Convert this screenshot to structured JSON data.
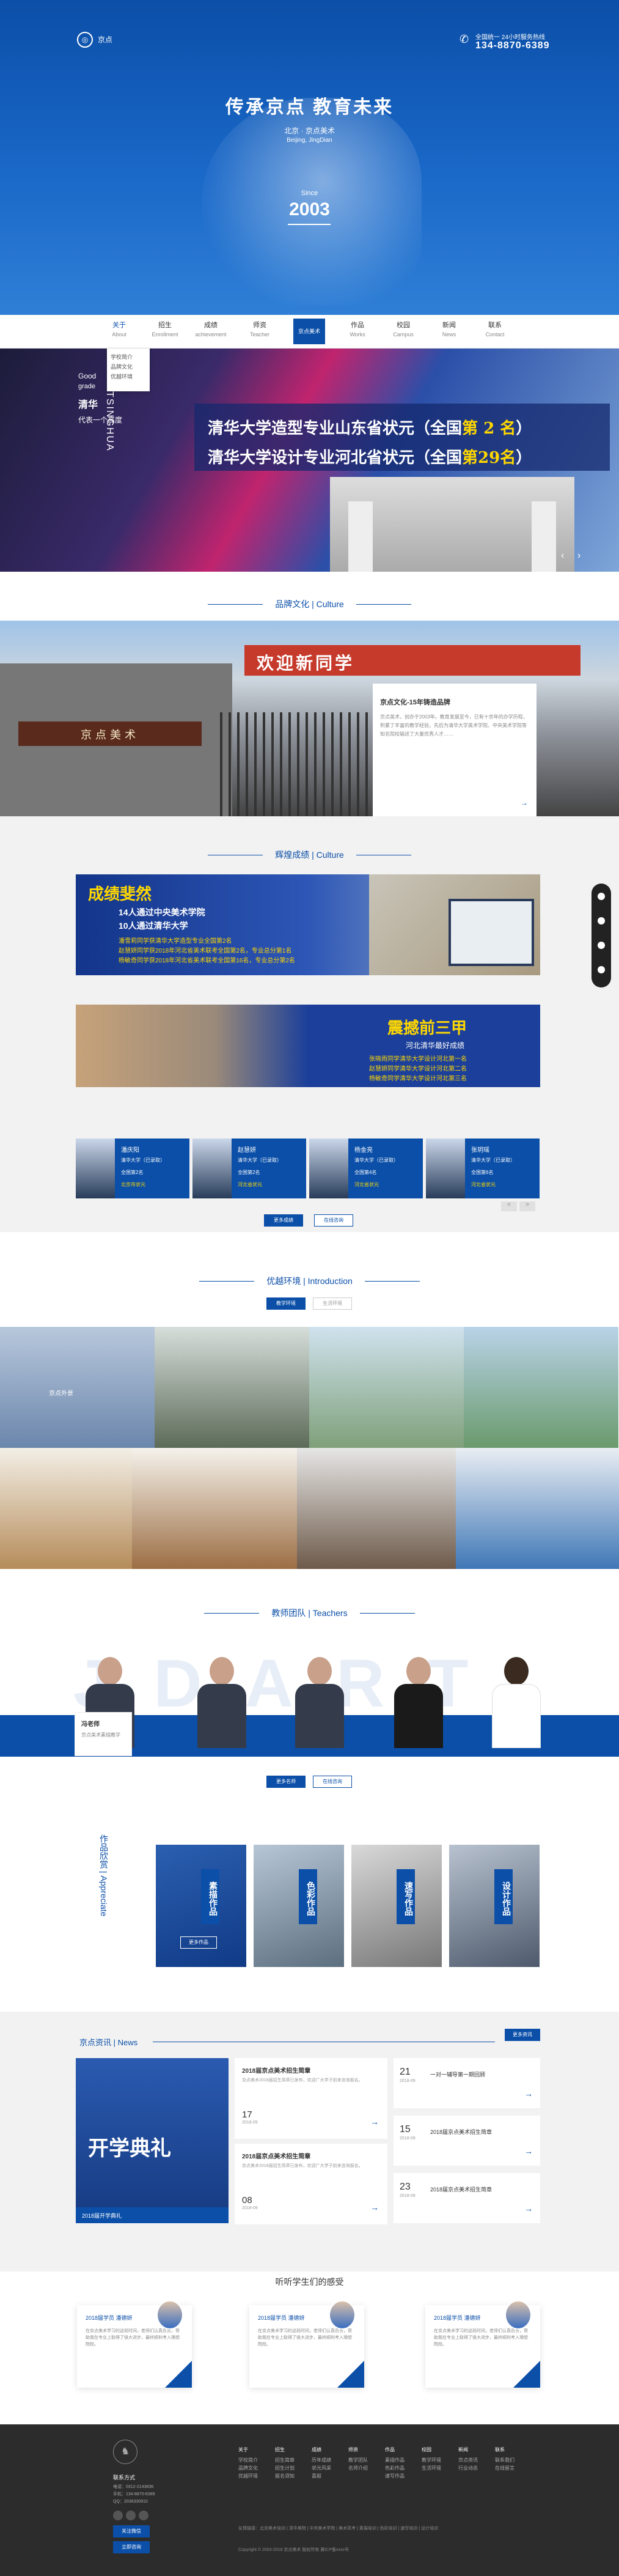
{
  "header": {
    "logo_icon": "logo-emblem-icon",
    "logo_text": "京点",
    "phone_label": "全国统一 24小时服务热线",
    "phone": "134-8870-6389",
    "title": "传承京点  教育未来",
    "subtitle_cn": "北京 · 京点美术",
    "subtitle_en": "Beijing, JingDian",
    "since_label": "Since",
    "since_year": "2003"
  },
  "nav": {
    "items": [
      {
        "cn": "关于",
        "en": "About"
      },
      {
        "cn": "招生",
        "en": "Enrollment"
      },
      {
        "cn": "成绩",
        "en": "achievement"
      },
      {
        "cn": "师资",
        "en": "Teacher"
      },
      {
        "cn": "作品",
        "en": "Works"
      },
      {
        "cn": "校园",
        "en": "Campus"
      },
      {
        "cn": "新闻",
        "en": "News"
      },
      {
        "cn": "联系",
        "en": "Contact"
      }
    ],
    "logo_text": "京点美术",
    "dropdown": [
      "学校简介",
      "品牌文化",
      "优越环境"
    ]
  },
  "banner": {
    "good": "Good",
    "grade": "grade",
    "vertical": "TSINGHUA",
    "qinghua": "清华",
    "daibiao": "代表一个高度",
    "line1_pre": "清华大学造型专业山东省状元（全国",
    "line1_num": "第 2 名",
    "line1_post": "）",
    "line2_pre": "清华大学设计专业河北省状元（全国",
    "line2_num": "第29名",
    "line2_post": "）"
  },
  "culture": {
    "title": "品牌文化 | Culture",
    "sign": "京点美术",
    "red_banner": "欢迎新同学",
    "card_title": "京点文化-15年铸造品牌",
    "card_text": "京点美术，创办于2003年。教育发展至今，已有十余年的办学历程，积累了丰富的教学经验，先后为清华大学美术学院、中央美术学院等知名院校输送了大量优秀人才……",
    "more": "→"
  },
  "achievement": {
    "title": "辉煌成绩 | Culture",
    "a1_head": "成绩斐然",
    "a1_l1": "14人通过中央美术学院",
    "a1_l2": "10人通过清华大学",
    "a1_l3": "潘雪莉同学获清华大学造型专业全国第2名",
    "a1_l4": "赵慧妍同学获2018年河北省美术联考全国第2名，专业总分第1名",
    "a1_l5": "杨敏奇同学获2018年河北省美术联考全国第16名，专业总分第2名",
    "a2_head": "震撼前三甲",
    "a2_sub": "河北清华最好成绩",
    "a2_l1": "张晓雨同学清华大学设计河北第一名",
    "a2_l2": "赵慧妍同学清华大学设计河北第二名",
    "a2_l3": "杨敏奇同学清华大学设计河北第三名",
    "students": [
      {
        "name": "潘庆阳",
        "school": "清华大学（已录取）",
        "rank": "全国第2名",
        "tag": "北京市状元"
      },
      {
        "name": "赵慧妍",
        "school": "清华大学（已录取）",
        "rank": "全国第2名",
        "tag": "河北省状元"
      },
      {
        "name": "杨金亮",
        "school": "清华大学（已录取）",
        "rank": "全国第4名",
        "tag": "河北省状元"
      },
      {
        "name": "张玥瑶",
        "school": "清华大学（已录取）",
        "rank": "全国第6名",
        "tag": "河北省状元"
      }
    ],
    "prev": "<",
    "next": ">",
    "btn_more": "更多成绩",
    "btn_consult": "在线咨询"
  },
  "environment": {
    "title": "优越环境 | Introduction",
    "tab1": "教学环境",
    "tab2": "生活环境",
    "first_caption": "京点外景"
  },
  "teachers": {
    "title": "教师团队 | Teachers",
    "bg_letters": "JDART",
    "card_name": "冯老师",
    "card_desc": "京点美术素描教学",
    "btn_more": "更多名师",
    "btn_consult": "在线咨询"
  },
  "appreciate": {
    "title": "作品欣赏 | Appreciate",
    "items": [
      "素描作品",
      "色彩作品",
      "速写作品",
      "设计作品"
    ],
    "first_btn": "更多作品"
  },
  "news": {
    "title": "京点资讯 | News",
    "more": "更多资讯",
    "big_text": "开学典礼",
    "big_caption": "2018届开学典礼",
    "mid": [
      {
        "title": "2018届京点美术招生简章",
        "text": "京点美术2018届招生简章已发布，欢迎广大学子前来咨询报名。",
        "day": "17",
        "ym": "2018-09"
      },
      {
        "title": "2018届京点美术招生简章",
        "text": "京点美术2018届招生简章已发布，欢迎广大学子前来咨询报名。",
        "day": "08",
        "ym": "2018-09"
      }
    ],
    "right": [
      {
        "day": "21",
        "ym": "2018-09",
        "title": "一对一辅导第一期回顾"
      },
      {
        "day": "15",
        "ym": "2018-09",
        "title": "2018届京点美术招生简章"
      },
      {
        "day": "23",
        "ym": "2018-09",
        "title": "2018届京点美术招生简章"
      }
    ]
  },
  "testimonials": {
    "title": "听听学生们的感受",
    "items": [
      {
        "name": "2018届学员 潘德妍",
        "text": "在京点美术学习的这段时间，老师们认真负责，帮助我在专业上取得了很大进步，最终顺利考入理想院校。"
      },
      {
        "name": "2018届学员 潘德妍",
        "text": "在京点美术学习的这段时间，老师们认真负责，帮助我在专业上取得了很大进步，最终顺利考入理想院校。"
      },
      {
        "name": "2018届学员 潘德妍",
        "text": "在京点美术学习的这段时间，老师们认真负责，帮助我在专业上取得了很大进步，最终顺利考入理想院校。"
      }
    ]
  },
  "footer": {
    "contact_title": "联系方式",
    "contact": [
      "电话：0312-2143836",
      "手机：134-8870-6389",
      "QQ：2036330910"
    ],
    "follow_btn": "关注微信",
    "consult_btn": "立即咨询",
    "cols": [
      {
        "head": "关于",
        "items": [
          "学校简介",
          "品牌文化",
          "优越环境"
        ]
      },
      {
        "head": "招生",
        "items": [
          "招生简章",
          "招生计划",
          "报名须知"
        ]
      },
      {
        "head": "成绩",
        "items": [
          "历年成绩",
          "状元风采",
          "喜报"
        ]
      },
      {
        "head": "师资",
        "items": [
          "教学团队",
          "名师介绍"
        ]
      },
      {
        "head": "作品",
        "items": [
          "素描作品",
          "色彩作品",
          "速写作品"
        ]
      },
      {
        "head": "校园",
        "items": [
          "教学环境",
          "生活环境"
        ]
      },
      {
        "head": "新闻",
        "items": [
          "京点资讯",
          "行业动态"
        ]
      },
      {
        "head": "联系",
        "items": [
          "联系我们",
          "在线留言"
        ]
      }
    ],
    "friend_links": "友情链接：北京美术培训 | 清华美院 | 中央美术学院 | 美术高考 | 素描培训 | 色彩培训 | 速写培训 | 设计培训",
    "copyright": "Copyright © 2003-2018 京点美术 版权所有  冀ICP备xxxx号"
  },
  "float": {
    "icons": [
      "user-icon",
      "phone-icon",
      "qq-icon",
      "wechat-icon"
    ]
  },
  "colors": {
    "brand": "#0b4fa8",
    "highlight": "#ffd800",
    "footer": "#2c2c2c"
  }
}
